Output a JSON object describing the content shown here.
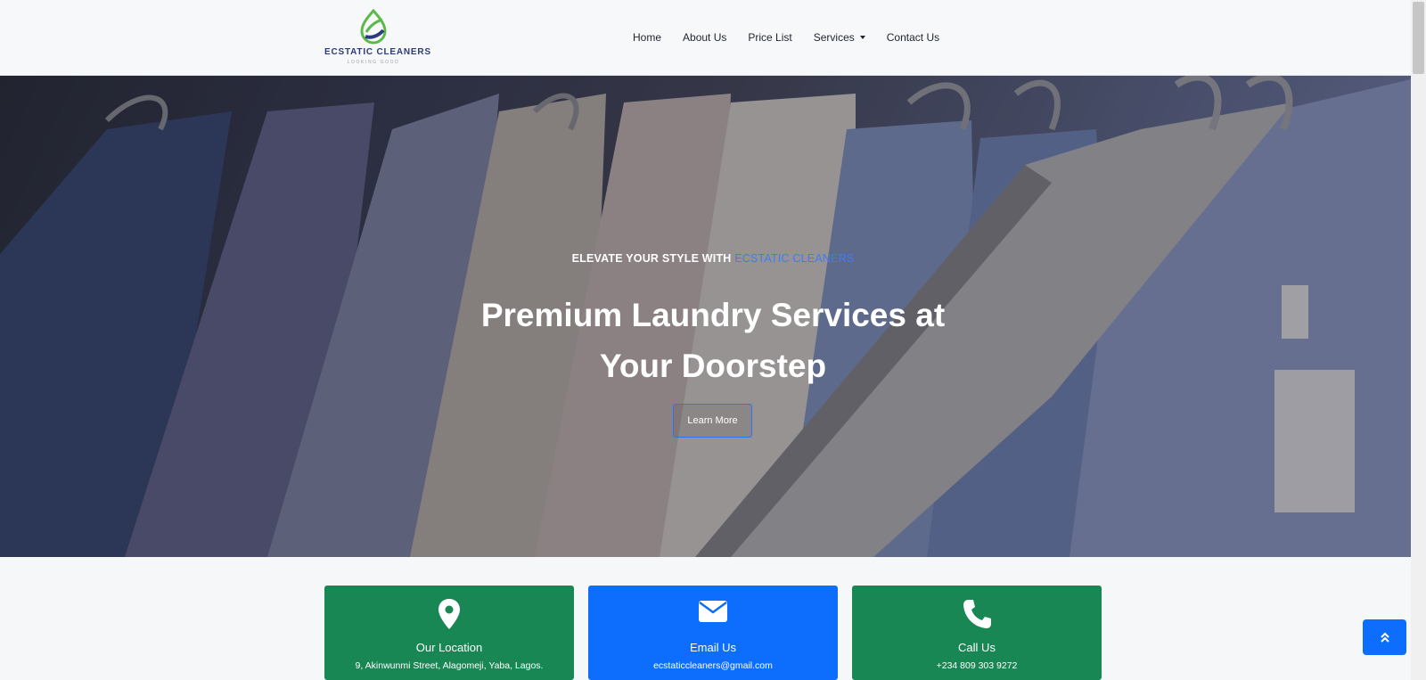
{
  "brand": {
    "name": "ECSTATIC CLEANERS",
    "tagline": "LOOKING GOOD",
    "colors": {
      "green": "#5bb947",
      "navy": "#2d3b7c"
    }
  },
  "nav": {
    "items": [
      {
        "label": "Home"
      },
      {
        "label": "About Us"
      },
      {
        "label": "Price List"
      },
      {
        "label": "Services",
        "has_dropdown": true
      },
      {
        "label": "Contact Us"
      }
    ]
  },
  "hero": {
    "subtitle_prefix": "ELEVATE YOUR STYLE WITH ",
    "subtitle_accent": "ECSTATIC CLEANERS",
    "title": "Premium Laundry Services at Your Doorstep",
    "button_label": "Learn More",
    "accent_color": "#3f7bf6"
  },
  "cards": [
    {
      "icon": "map-pin-icon",
      "title": "Our Location",
      "text": "9, Akinwunmi Street, Alagomeji, Yaba, Lagos.",
      "color": "#198754"
    },
    {
      "icon": "envelope-icon",
      "title": "Email Us",
      "text": "ecstaticcleaners@gmail.com",
      "color": "#0d6efd"
    },
    {
      "icon": "phone-icon",
      "title": "Call Us",
      "text": "+234 809 303 9272",
      "color": "#198754"
    }
  ],
  "back_to_top": {
    "icon": "double-chevron-up-icon"
  }
}
